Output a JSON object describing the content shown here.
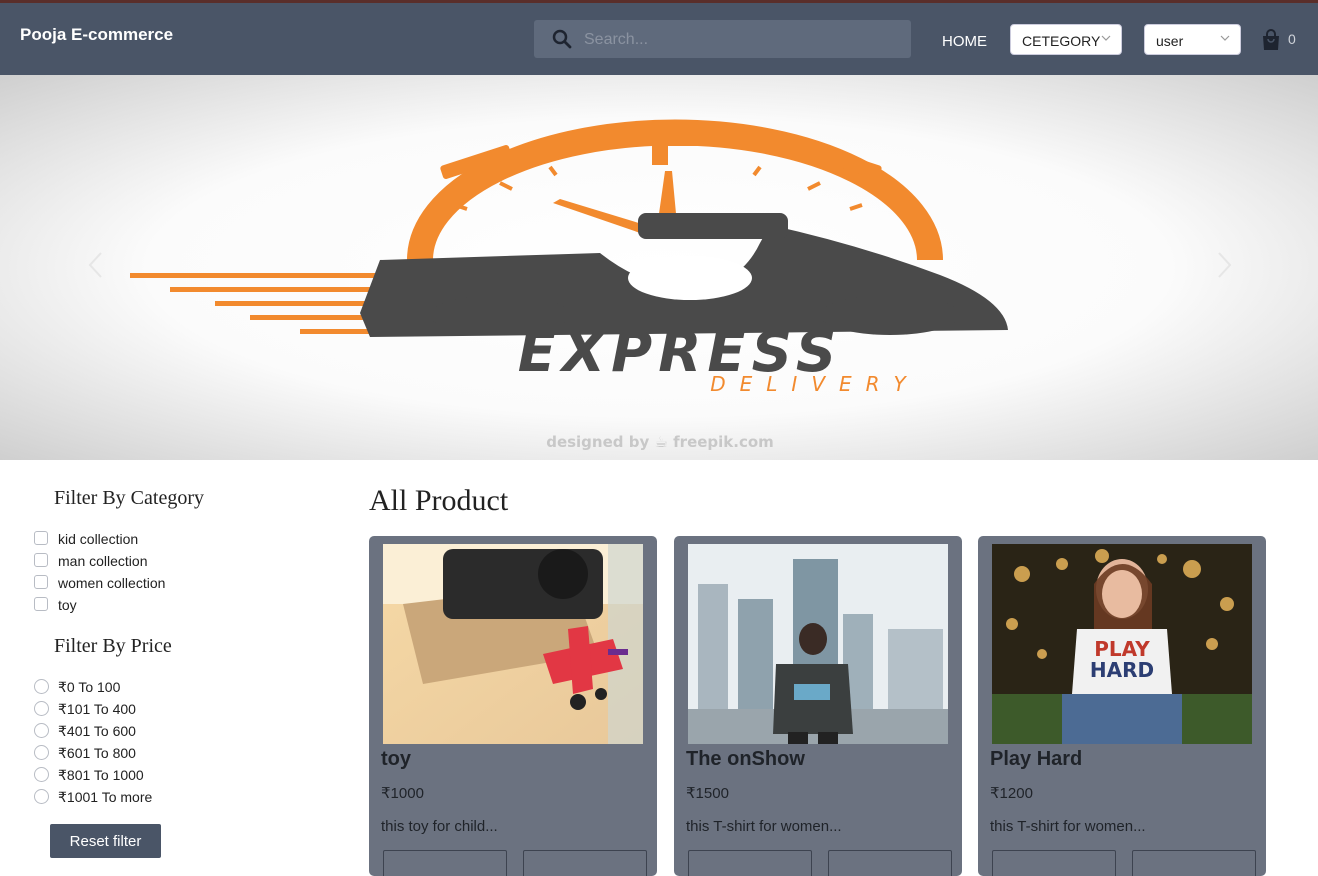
{
  "navbar": {
    "brand": "Pooja E-commerce",
    "search_placeholder": "Search...",
    "home_label": "HOME",
    "category_label": "CETEGORY",
    "user_label": "user",
    "cart_count": "0"
  },
  "banner": {
    "headline": "EXPRESS",
    "subline": "DELIVERY",
    "credit": "designed by ☕ freepik.com"
  },
  "sidebar": {
    "category_title": "Filter By Category",
    "categories": [
      "kid collection",
      "man collection",
      "women collection",
      "toy"
    ],
    "price_title": "Filter By Price",
    "prices": [
      "₹0 To 100",
      "₹101 To 400",
      "₹401 To 600",
      "₹601 To 800",
      "₹801 To 1000",
      "₹1001 To more"
    ],
    "reset_label": "Reset filter"
  },
  "main": {
    "title": "All Product",
    "products": [
      {
        "name": "toy",
        "price": "₹1000",
        "desc": "this toy for child..."
      },
      {
        "name": "The onShow",
        "price": "₹1500",
        "desc": "this T-shirt for women..."
      },
      {
        "name": "Play Hard",
        "price": "₹1200",
        "desc": "this T-shirt for women..."
      }
    ]
  },
  "colors": {
    "navbar": "#4a5567",
    "card": "#6b7280",
    "accent_orange": "#f28a2e",
    "dark_gray": "#4a4a4a"
  }
}
